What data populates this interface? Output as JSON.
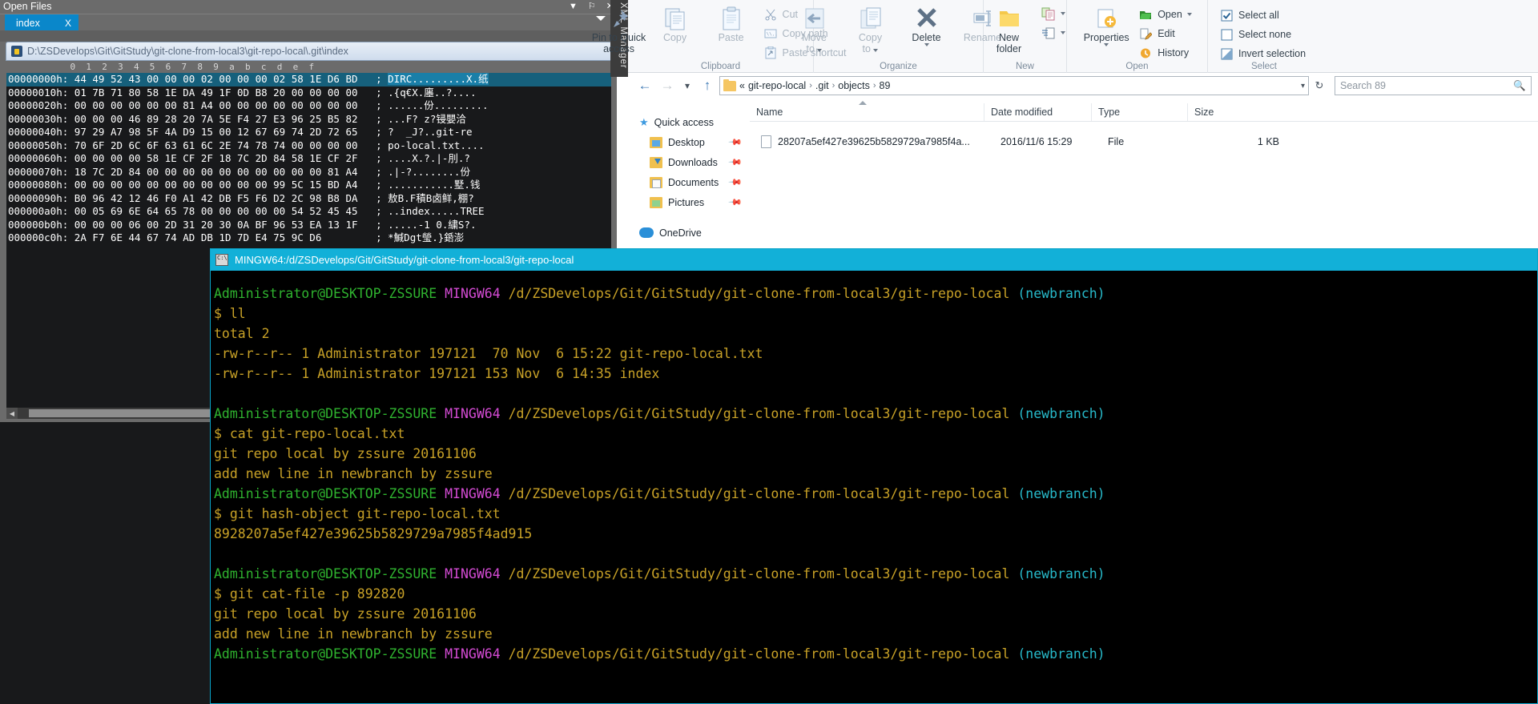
{
  "hex_editor": {
    "title": "Open Files",
    "window_buttons": [
      "▼",
      "⚐",
      "✕"
    ],
    "tab": {
      "label": "index",
      "close": "X"
    },
    "path": "D:\\ZSDevelops\\Git\\GitStudy\\git-clone-from-local3\\git-repo-local\\.git\\index",
    "column_header": "            0  1  2  3  4  5  6  7  8  9  a  b  c  d  e  f",
    "rows": [
      {
        "offset": "00000000h:",
        "bytes": "44 49 52 43 00 00 00 02 00 00 00 02 58 1E D6 BD",
        "ascii": "DIRC.........X.纸",
        "selected": true
      },
      {
        "offset": "00000010h:",
        "bytes": "01 7B 71 80 58 1E DA 49 1F 0D B8 20 00 00 00 00",
        "ascii": ".{q€X.廛..?....",
        "selected": false
      },
      {
        "offset": "00000020h:",
        "bytes": "00 00 00 00 00 00 81 A4 00 00 00 00 00 00 00 00",
        "ascii": "......份.........",
        "selected": false
      },
      {
        "offset": "00000030h:",
        "bytes": "00 00 00 46 89 28 20 7A 5E F4 27 E3 96 25 B5 82",
        "ascii": "...F? z?锓嬰洽",
        "selected": false
      },
      {
        "offset": "00000040h:",
        "bytes": "97 29 A7 98 5F 4A D9 15 00 12 67 69 74 2D 72 65",
        "ascii": "?  _J?..git-re",
        "selected": false
      },
      {
        "offset": "00000050h:",
        "bytes": "70 6F 2D 6C 6F 63 61 6C 2E 74 78 74 00 00 00 00",
        "ascii": "po-local.txt....",
        "selected": false
      },
      {
        "offset": "00000060h:",
        "bytes": "00 00 00 00 58 1E CF 2F 18 7C 2D 84 58 1E CF 2F",
        "ascii": "....X.?.|-刖.?",
        "selected": false
      },
      {
        "offset": "00000070h:",
        "bytes": "18 7C 2D 84 00 00 00 00 00 00 00 00 00 00 81 A4",
        "ascii": ".|-?........份",
        "selected": false
      },
      {
        "offset": "00000080h:",
        "bytes": "00 00 00 00 00 00 00 00 00 00 00 99 5C 15 BD A4",
        "ascii": "...........墅.钱",
        "selected": false
      },
      {
        "offset": "00000090h:",
        "bytes": "B0 96 42 12 46 F0 A1 42 DB F5 F6 D2 2C 98 B8 DA",
        "ascii": "敖B.F積B卤鲜,棚?",
        "selected": false
      },
      {
        "offset": "000000a0h:",
        "bytes": "00 05 69 6E 64 65 78 00 00 00 00 00 54 52 45 45",
        "ascii": "..index.....TREE",
        "selected": false
      },
      {
        "offset": "000000b0h:",
        "bytes": "00 00 00 06 00 2D 31 20 30 0A BF 96 53 EA 13 1F",
        "ascii": ".....-1 0.繍S?.",
        "selected": false
      },
      {
        "offset": "000000c0h:",
        "bytes": "2A F7 6E 44 67 74 AD DB 1D 7D E4 75 9C D6",
        "ascii": "*鰔Dgt瑩.}銽澎",
        "selected": false
      }
    ],
    "xml_manager_tab": "XML Manager"
  },
  "explorer": {
    "ribbon": {
      "groups": [
        {
          "label": "Clipboard",
          "big_buttons": [
            {
              "label": "Pin to Quick\naccess",
              "icon": "pin-icon",
              "disabled": false
            },
            {
              "label": "Copy",
              "icon": "copy-icon",
              "disabled": true
            },
            {
              "label": "Paste",
              "icon": "paste-icon",
              "disabled": true
            }
          ],
          "small_buttons": [
            {
              "label": "Cut",
              "icon": "scissors-icon",
              "disabled": true
            },
            {
              "label": "Copy path",
              "icon": "copy-path-icon",
              "disabled": true
            },
            {
              "label": "Paste shortcut",
              "icon": "paste-shortcut-icon",
              "disabled": true
            }
          ]
        },
        {
          "label": "Organize",
          "big_buttons": [
            {
              "label": "Move\nto",
              "icon": "move-to-icon",
              "disabled": true,
              "dropdown": true
            },
            {
              "label": "Copy\nto",
              "icon": "copy-to-icon",
              "disabled": true,
              "dropdown": true
            },
            {
              "label": "Delete",
              "icon": "delete-icon",
              "disabled": false,
              "dropdown": true
            },
            {
              "label": "Rename",
              "icon": "rename-icon",
              "disabled": true
            }
          ],
          "small_buttons": []
        },
        {
          "label": "New",
          "big_buttons": [
            {
              "label": "New\nfolder",
              "icon": "new-folder-icon",
              "disabled": false
            }
          ],
          "small_buttons": [
            {
              "label": "",
              "icon": "new-item-icon",
              "disabled": false,
              "dropdown": true
            },
            {
              "label": "",
              "icon": "easy-access-icon",
              "disabled": false,
              "dropdown": true
            }
          ]
        },
        {
          "label": "Open",
          "big_buttons": [
            {
              "label": "Properties",
              "icon": "properties-icon",
              "disabled": false,
              "dropdown": true
            }
          ],
          "small_buttons": [
            {
              "label": "Open",
              "icon": "open-icon",
              "disabled": false,
              "dropdown": true
            },
            {
              "label": "Edit",
              "icon": "edit-icon",
              "disabled": false
            },
            {
              "label": "History",
              "icon": "history-icon",
              "disabled": false
            }
          ]
        },
        {
          "label": "Select",
          "big_buttons": [],
          "small_buttons": [
            {
              "label": "Select all",
              "icon": "select-all-icon",
              "disabled": false
            },
            {
              "label": "Select none",
              "icon": "select-none-icon",
              "disabled": false
            },
            {
              "label": "Invert selection",
              "icon": "invert-selection-icon",
              "disabled": false
            }
          ]
        }
      ]
    },
    "address": {
      "back_icon": "back-arrow-icon",
      "forward_icon": "forward-arrow-icon",
      "recent_icon": "recent-locations-icon",
      "up_icon": "up-arrow-icon",
      "overflow": "«",
      "crumbs": [
        "git-repo-local",
        ".git",
        "objects",
        "89"
      ],
      "separator": "›",
      "dropdown_icon": "chevron-down-icon",
      "refresh_icon": "refresh-icon",
      "search_placeholder": "Search 89",
      "search_value": "",
      "search_icon": "search-icon"
    },
    "nav_pane": {
      "quick_access": {
        "label": "Quick access",
        "icon": "star-icon"
      },
      "items": [
        {
          "label": "Desktop",
          "icon": "desktop-folder-icon",
          "pinned": true
        },
        {
          "label": "Downloads",
          "icon": "downloads-folder-icon",
          "pinned": true
        },
        {
          "label": "Documents",
          "icon": "documents-folder-icon",
          "pinned": true
        },
        {
          "label": "Pictures",
          "icon": "pictures-folder-icon",
          "pinned": true
        }
      ],
      "onedrive": {
        "label": "OneDrive",
        "icon": "onedrive-icon"
      }
    },
    "file_list": {
      "columns": [
        "Name",
        "Date modified",
        "Type",
        "Size"
      ],
      "sorted_by": "Name",
      "rows": [
        {
          "name": "28207a5ef427e39625b5829729a7985f4a...",
          "date_modified": "2016/11/6 15:29",
          "type": "File",
          "size": "1 KB",
          "icon": "file-icon"
        }
      ]
    }
  },
  "terminal": {
    "title": "MINGW64:/d/ZSDevelops/Git/GitStudy/git-clone-from-local3/git-repo-local",
    "icon": "console-icon",
    "prompt_user": "Administrator@DESKTOP-ZSSURE",
    "prompt_shell": "MINGW64",
    "prompt_path": "/d/ZSDevelops/Git/GitStudy/git-clone-from-local3/git-repo-local",
    "prompt_branch": "(newbranch)",
    "lines": [
      {
        "type": "prompt"
      },
      {
        "type": "cmd",
        "text": "$ ll"
      },
      {
        "type": "out",
        "text": "total 2"
      },
      {
        "type": "out",
        "text": "-rw-r--r-- 1 Administrator 197121  70 Nov  6 15:22 git-repo-local.txt"
      },
      {
        "type": "out",
        "text": "-rw-r--r-- 1 Administrator 197121 153 Nov  6 14:35 index"
      },
      {
        "type": "blank"
      },
      {
        "type": "prompt"
      },
      {
        "type": "cmd",
        "text": "$ cat git-repo-local.txt"
      },
      {
        "type": "out",
        "text": "git repo local by zssure 20161106"
      },
      {
        "type": "out",
        "text": "add new line in newbranch by zssure"
      },
      {
        "type": "prompt"
      },
      {
        "type": "cmd",
        "text": "$ git hash-object git-repo-local.txt"
      },
      {
        "type": "out",
        "text": "8928207a5ef427e39625b5829729a7985f4ad915"
      },
      {
        "type": "blank"
      },
      {
        "type": "prompt"
      },
      {
        "type": "cmd",
        "text": "$ git cat-file -p 892820"
      },
      {
        "type": "out",
        "text": "git repo local by zssure 20161106"
      },
      {
        "type": "out",
        "text": "add new line in newbranch by zssure"
      },
      {
        "type": "prompt"
      }
    ]
  }
}
